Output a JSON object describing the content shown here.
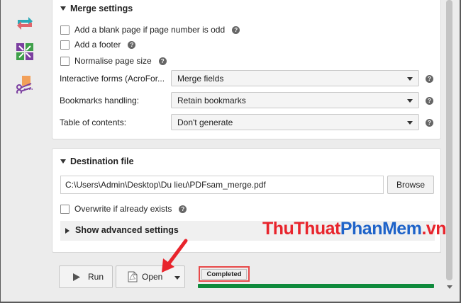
{
  "merge_settings": {
    "title": "Merge settings",
    "options": [
      {
        "label": "Add a blank page if page number is odd",
        "checked": false
      },
      {
        "label": "Add a footer",
        "checked": false
      },
      {
        "label": "Normalise page size",
        "checked": false
      }
    ],
    "fields": [
      {
        "label": "Interactive forms (AcroFor...",
        "value": "Merge fields"
      },
      {
        "label": "Bookmarks handling:",
        "value": "Retain bookmarks"
      },
      {
        "label": "Table of contents:",
        "value": "Don't generate"
      }
    ]
  },
  "destination": {
    "title": "Destination file",
    "path": "C:\\Users\\Admin\\Desktop\\Du lieu\\PDFsam_merge.pdf",
    "browse_label": "Browse",
    "overwrite_label": "Overwrite if already exists",
    "overwrite_checked": false,
    "advanced_label": "Show advanced settings"
  },
  "footer": {
    "run_label": "Run",
    "open_label": "Open",
    "status": "Completed",
    "progress": 1.0
  },
  "help_glyph": "?",
  "watermark": {
    "part1": "ThuThuat",
    "part2": "PhanMem",
    "part3": ".vn"
  },
  "colors": {
    "accent_red": "#e84a4a",
    "progress_green": "#0f8a3c",
    "watermark_red": "#e8242c",
    "watermark_blue": "#1e63c9"
  },
  "icons": {
    "sidebar": [
      "rotate-icon",
      "split-icon",
      "extract-icon"
    ],
    "run": "play-icon",
    "open": "pdf-file-icon",
    "help": "help-icon"
  }
}
